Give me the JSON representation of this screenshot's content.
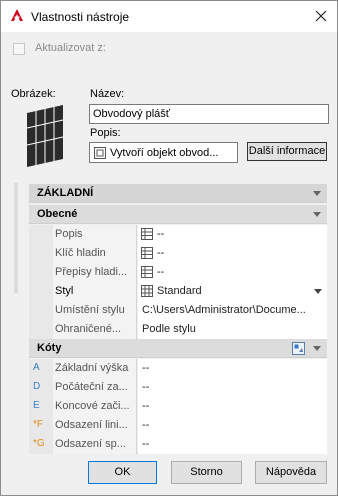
{
  "window": {
    "title": "Vlastnosti nástroje"
  },
  "update_checkbox": {
    "label": "Aktualizovat z:",
    "checked": false
  },
  "image_section": {
    "label": "Obrázek:"
  },
  "name": {
    "label": "Název:",
    "value": "Obvodový plášť"
  },
  "description": {
    "label": "Popis:",
    "value": "Vytvoří objekt obvod..."
  },
  "more_info_button": "Další informace",
  "grid": {
    "main_category": "ZÁKLADNÍ",
    "general": {
      "title": "Obecné",
      "rows": [
        {
          "label": "Popis",
          "value": "--",
          "icon": "table-icon"
        },
        {
          "label": "Klíč hladin",
          "value": "--",
          "icon": "table-icon"
        },
        {
          "label": "Přepisy hladi...",
          "value": "--",
          "icon": "table-icon"
        },
        {
          "label": "Styl",
          "value": "Standard",
          "icon": "grid-icon",
          "dropdown": true
        },
        {
          "label": "Umístění stylu",
          "value": "C:\\Users\\Administrator\\Docume..."
        },
        {
          "label": "Ohraničené...",
          "value": "Podle stylu"
        }
      ]
    },
    "dimensions": {
      "title": "Kóty",
      "rows": [
        {
          "marker": "A",
          "label": "Základní výška",
          "value": "--"
        },
        {
          "marker": "D",
          "label": "Počáteční za...",
          "value": "--"
        },
        {
          "marker": "E",
          "label": "Koncové zači...",
          "value": "--"
        },
        {
          "marker": "*F",
          "label": "Odsazení lini...",
          "value": "--"
        },
        {
          "marker": "*G",
          "label": "Odsazení sp...",
          "value": "--"
        }
      ]
    }
  },
  "buttons": {
    "ok": "OK",
    "cancel": "Storno",
    "help": "Nápověda"
  }
}
